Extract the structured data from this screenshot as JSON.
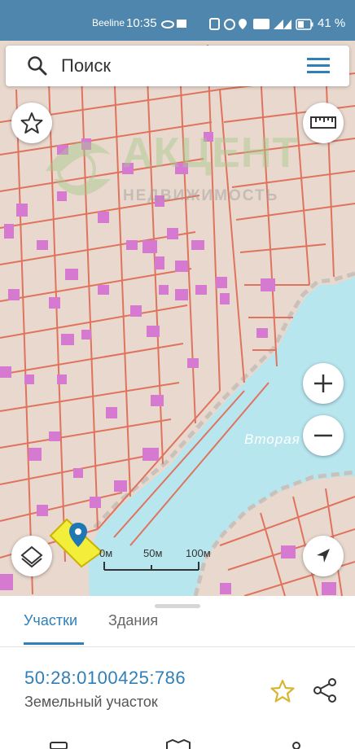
{
  "status_bar": {
    "carrier": "Beeline",
    "time": "10:35",
    "battery": "41 %"
  },
  "search": {
    "placeholder": "Поиск"
  },
  "watermark": {
    "title": "АКЦЕНТ",
    "subtitle": "НЕДВИЖИМОСТЬ"
  },
  "map": {
    "water_label": "Вторая",
    "scale_labels": [
      "0м",
      "50м",
      "100м"
    ]
  },
  "tabs": [
    {
      "label": "Участки",
      "active": true
    },
    {
      "label": "Здания",
      "active": false
    }
  ],
  "parcel": {
    "cadastral_number": "50:28:0100425:786",
    "type": "Земельный участок"
  },
  "colors": {
    "status_bar": "#4f86ad",
    "accent": "#2f7fb8",
    "land": "#e8d8cd",
    "water": "#b7e6ef",
    "parcel_line": "#e0735d",
    "building": "#d679d0",
    "selected_parcel": "#f3ee3a",
    "favorite_star": "#d8b530"
  },
  "icons": [
    "search-icon",
    "menu-icon",
    "star-icon",
    "ruler-icon",
    "zoom-in-icon",
    "zoom-out-icon",
    "layers-icon",
    "locate-icon",
    "map-pin-icon",
    "share-icon"
  ]
}
